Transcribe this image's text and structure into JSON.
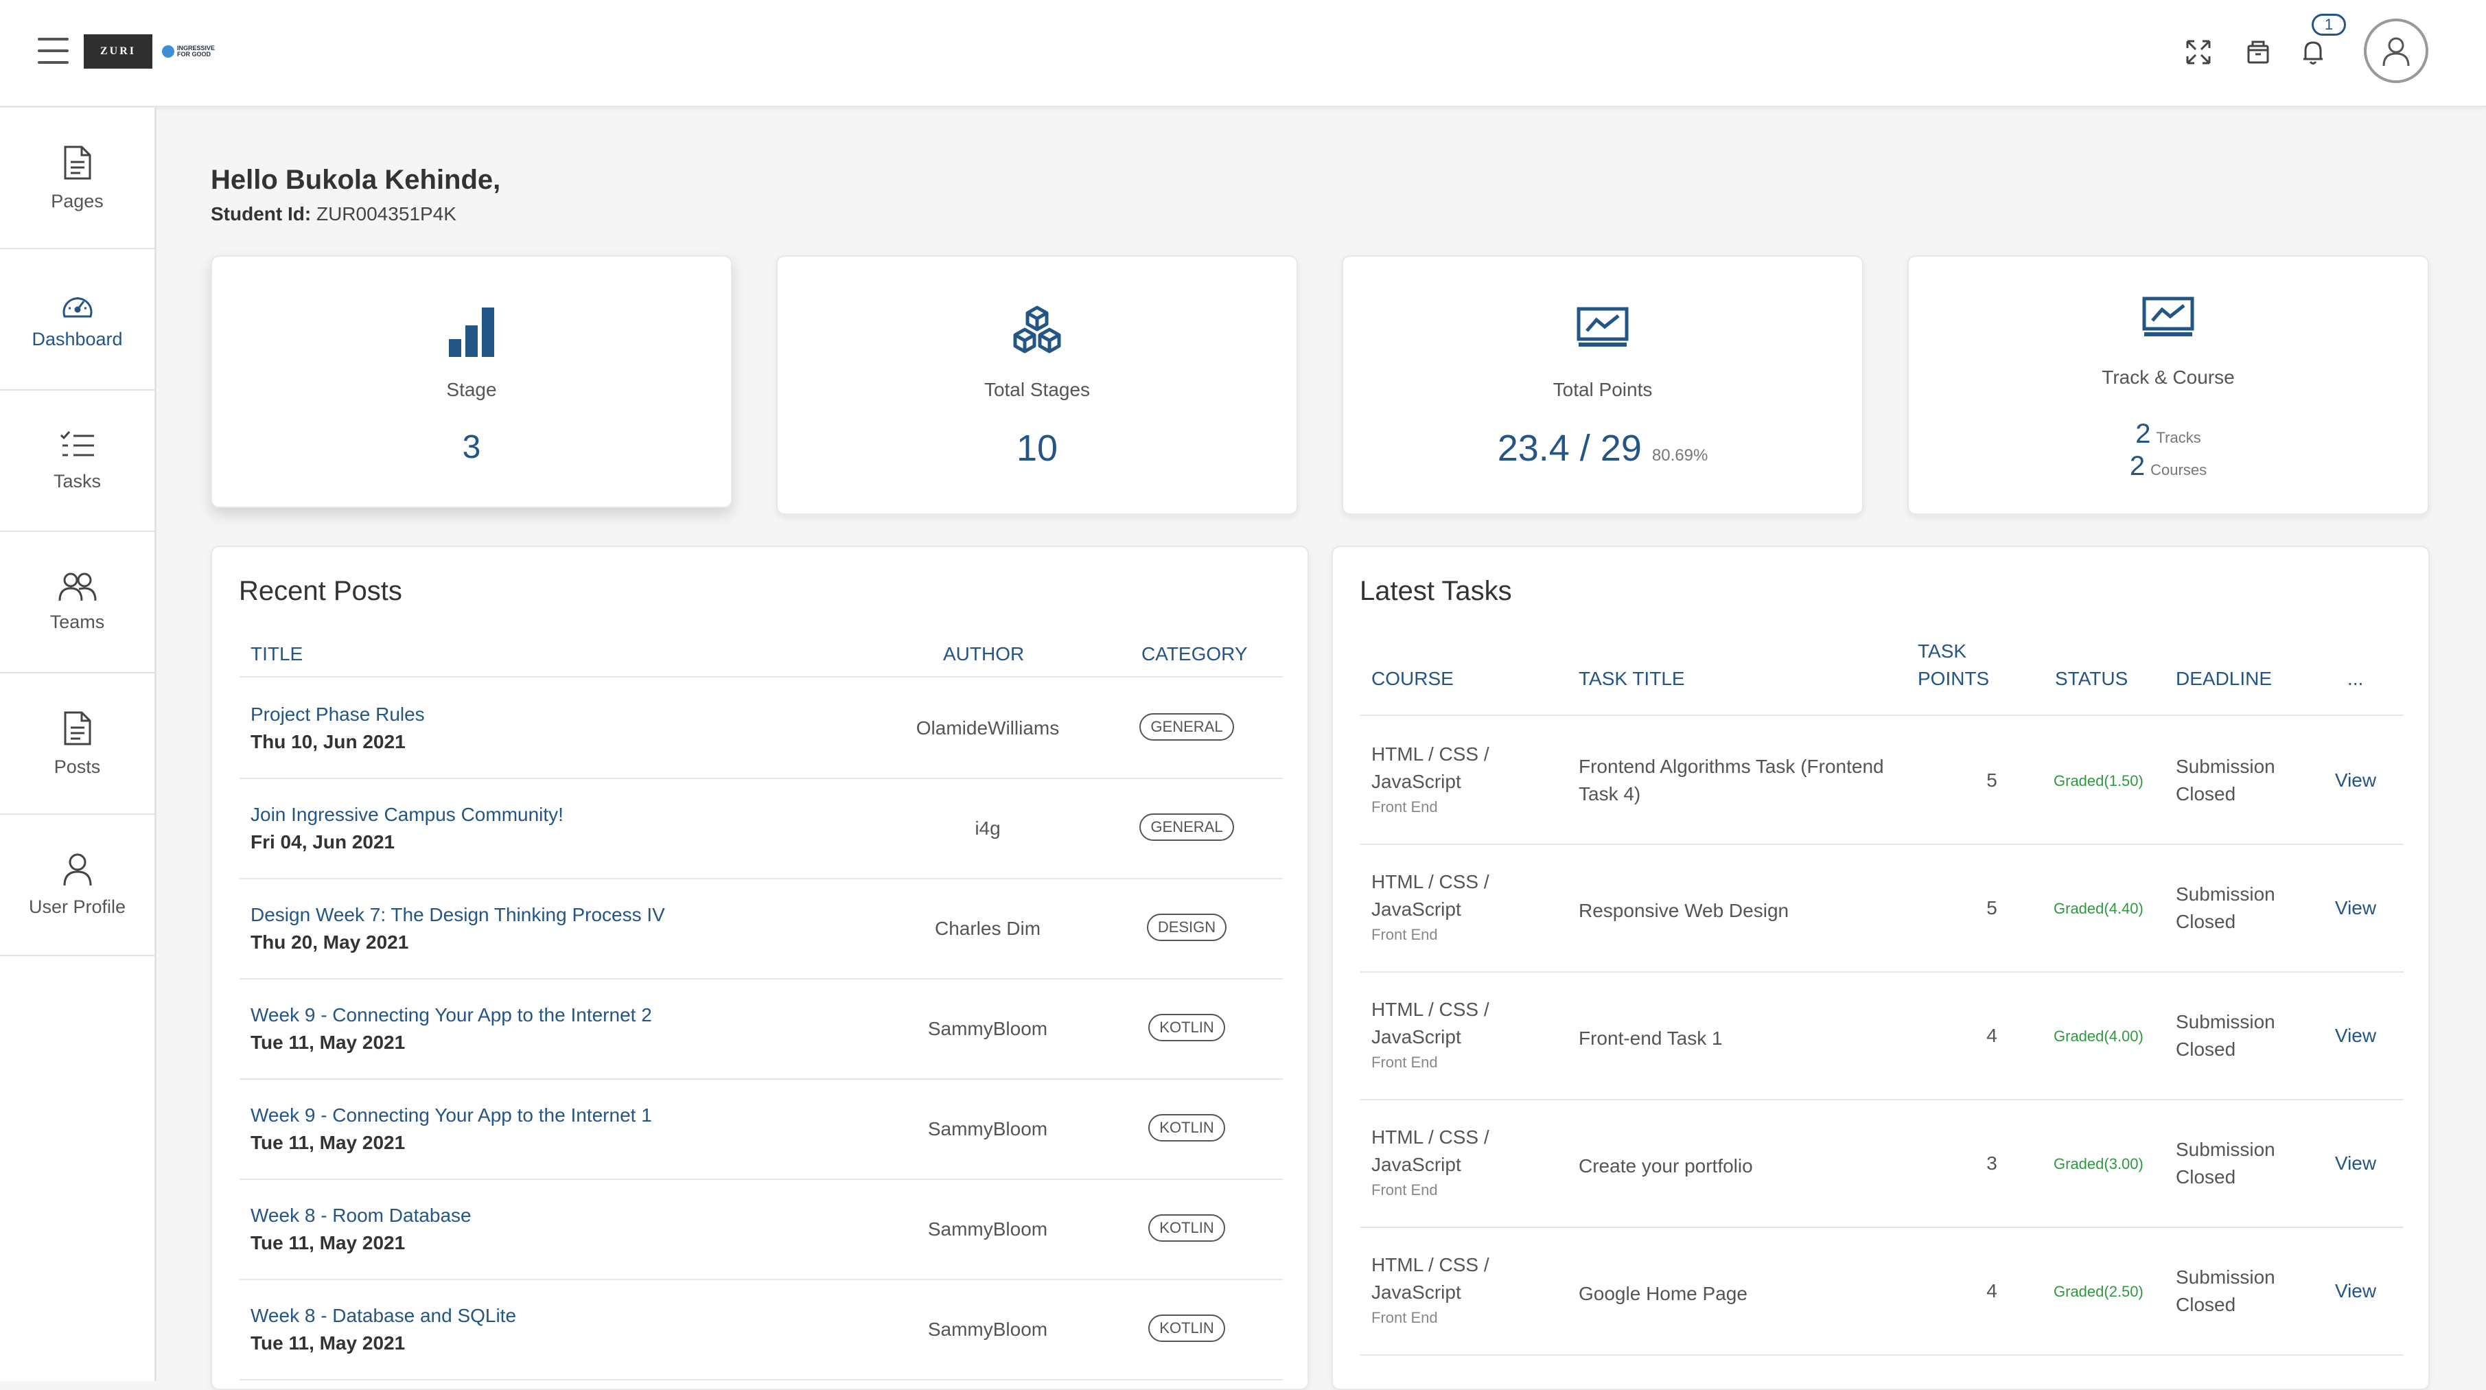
{
  "header": {
    "logo_text": "ZURI",
    "logo2_text": "INGRESSIVE FOR GOOD",
    "notification_count": "1",
    "icons": [
      "expand-icon",
      "bag-icon",
      "bell-icon",
      "user-icon"
    ]
  },
  "sidebar": {
    "items": [
      {
        "label": "Pages",
        "icon": "document-icon"
      },
      {
        "label": "Dashboard",
        "icon": "speedometer-icon"
      },
      {
        "label": "Tasks",
        "icon": "checklist-icon"
      },
      {
        "label": "Teams",
        "icon": "people-icon"
      },
      {
        "label": "Posts",
        "icon": "document-icon"
      },
      {
        "label": "User Profile",
        "icon": "user-icon"
      }
    ]
  },
  "greeting": {
    "hello": "Hello Bukola Kehinde,",
    "student_label": "Student Id:",
    "student_id": "ZUR004351P4K"
  },
  "stats": {
    "stage": {
      "title": "Stage",
      "value": "3"
    },
    "total_stages": {
      "title": "Total Stages",
      "value": "10"
    },
    "total_points": {
      "title": "Total Points",
      "value": "23.4 / 29",
      "percent": "80.69%"
    },
    "track_course": {
      "title": "Track & Course",
      "tracks": "2",
      "tracks_label": "Tracks",
      "courses": "2",
      "courses_label": "Courses"
    }
  },
  "recent_posts": {
    "title": "Recent Posts",
    "columns": {
      "title": "TITLE",
      "author": "AUTHOR",
      "category": "CATEGORY"
    },
    "rows": [
      {
        "title": "Project Phase Rules",
        "date": "Thu 10, Jun 2021",
        "author": "OlamideWilliams",
        "category": "GENERAL"
      },
      {
        "title": "Join Ingressive Campus Community!",
        "date": "Fri 04, Jun 2021",
        "author": "i4g",
        "category": "GENERAL"
      },
      {
        "title": "Design Week 7: The Design Thinking Process IV",
        "date": "Thu 20, May 2021",
        "author": "Charles Dim",
        "category": "DESIGN"
      },
      {
        "title": "Week 9 - Connecting Your App to the Internet 2",
        "date": "Tue 11, May 2021",
        "author": "SammyBloom",
        "category": "KOTLIN"
      },
      {
        "title": "Week 9 - Connecting Your App to the Internet 1",
        "date": "Tue 11, May 2021",
        "author": "SammyBloom",
        "category": "KOTLIN"
      },
      {
        "title": "Week 8 - Room Database",
        "date": "Tue 11, May 2021",
        "author": "SammyBloom",
        "category": "KOTLIN"
      },
      {
        "title": "Week 8 - Database and SQLite",
        "date": "Tue 11, May 2021",
        "author": "SammyBloom",
        "category": "KOTLIN"
      }
    ]
  },
  "latest_tasks": {
    "title": "Latest Tasks",
    "columns": {
      "course": "COURSE",
      "task_title": "TASK TITLE",
      "task_points_1": "TASK",
      "task_points_2": "POINTS",
      "status": "STATUS",
      "deadline": "DEADLINE",
      "more": "..."
    },
    "rows": [
      {
        "course_1": "HTML / CSS /",
        "course_2": "JavaScript",
        "track": "Front End",
        "title_1": "Frontend Algorithms Task (Frontend",
        "title_2": "Task 4)",
        "points": "5",
        "status": "Graded(1.50)",
        "deadline_1": "Submission",
        "deadline_2": "Closed",
        "action": "View"
      },
      {
        "course_1": "HTML / CSS /",
        "course_2": "JavaScript",
        "track": "Front End",
        "title_1": "Responsive Web Design",
        "title_2": "",
        "points": "5",
        "status": "Graded(4.40)",
        "deadline_1": "Submission",
        "deadline_2": "Closed",
        "action": "View"
      },
      {
        "course_1": "HTML / CSS /",
        "course_2": "JavaScript",
        "track": "Front End",
        "title_1": "Front-end Task 1",
        "title_2": "",
        "points": "4",
        "status": "Graded(4.00)",
        "deadline_1": "Submission",
        "deadline_2": "Closed",
        "action": "View"
      },
      {
        "course_1": "HTML / CSS /",
        "course_2": "JavaScript",
        "track": "Front End",
        "title_1": "Create your portfolio",
        "title_2": "",
        "points": "3",
        "status": "Graded(3.00)",
        "deadline_1": "Submission",
        "deadline_2": "Closed",
        "action": "View"
      },
      {
        "course_1": "HTML / CSS /",
        "course_2": "JavaScript",
        "track": "Front End",
        "title_1": "Google Home Page",
        "title_2": "",
        "points": "4",
        "status": "Graded(2.50)",
        "deadline_1": "Submission",
        "deadline_2": "Closed",
        "action": "View"
      }
    ]
  },
  "colors": {
    "accent": "#245587",
    "graded": "#2e9a3e",
    "background": "#f5f5f5"
  }
}
